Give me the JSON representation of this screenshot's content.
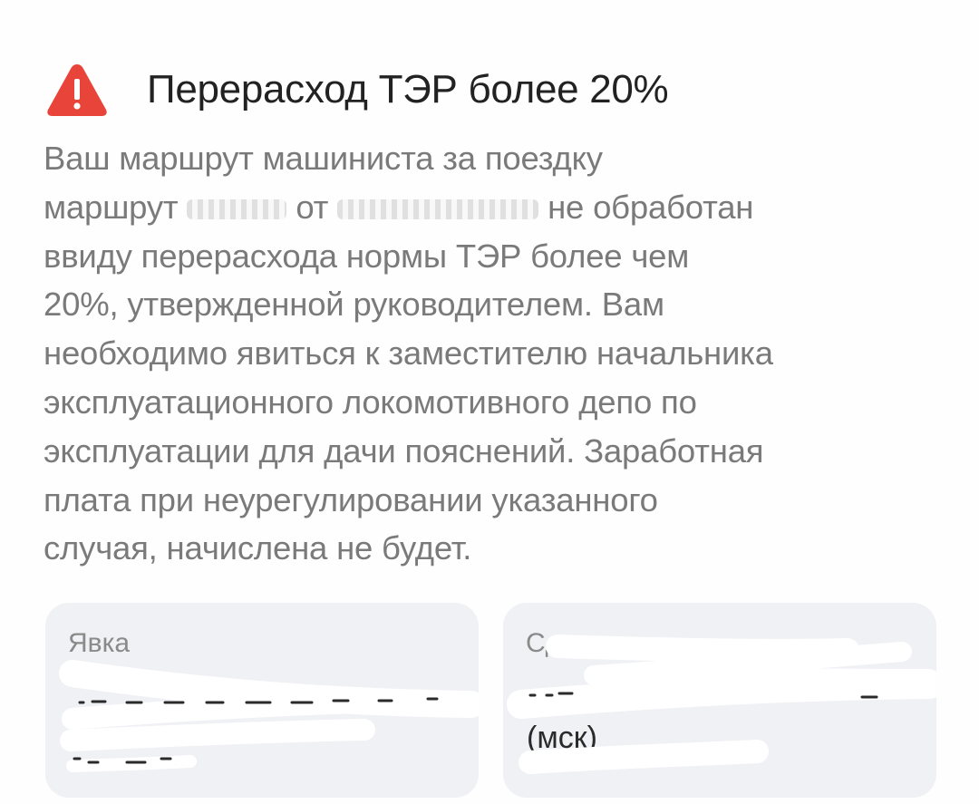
{
  "alert": {
    "icon": "warning-triangle-icon",
    "icon_color": "#e8443a",
    "title": "Перерасход ТЭР более 20%"
  },
  "message": {
    "line1": "Ваш маршрут машиниста за поездку",
    "line2_prefix": "маршрут",
    "line2_mid": "от",
    "line2_suffix": "не обработан",
    "line3": "ввиду перерасхода нормы ТЭР более чем",
    "line4": "20%, утвержденной руководителем. Вам",
    "line5": "необходимо явиться к заместителю начальника",
    "line6": "эксплуатационного локомотивного депо по",
    "line7": "эксплуатации для дачи пояснений. Заработная",
    "line8": "плата при неурегулировании указанного",
    "line9": "случая, начислена не будет."
  },
  "cards": {
    "arrival": {
      "label": "Явка"
    },
    "handover": {
      "label": "Сдача",
      "value_suffix": "(мск)"
    }
  }
}
